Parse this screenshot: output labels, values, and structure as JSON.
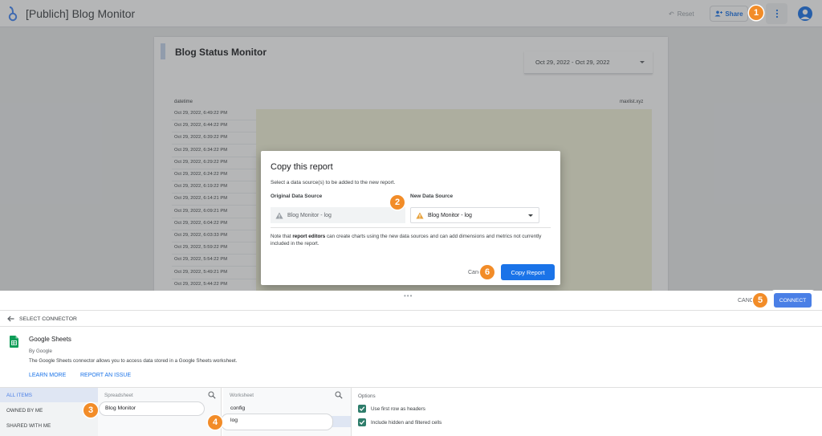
{
  "app": {
    "title": "[Publich] Blog Monitor",
    "reset_label": "Reset",
    "share_label": "Share"
  },
  "report": {
    "title": "Blog Status Monitor",
    "date_range": "Oct 29, 2022 - Oct 29, 2022",
    "columns": [
      "datetime",
      "maxlist.xyz"
    ],
    "rows": [
      "Oct 29, 2022, 6:49:22 PM",
      "Oct 29, 2022, 6:44:22 PM",
      "Oct 29, 2022, 6:39:22 PM",
      "Oct 29, 2022, 6:34:22 PM",
      "Oct 29, 2022, 6:29:22 PM",
      "Oct 29, 2022, 6:24:22 PM",
      "Oct 29, 2022, 6:19:22 PM",
      "Oct 29, 2022, 6:14:21 PM",
      "Oct 29, 2022, 6:09:21 PM",
      "Oct 29, 2022, 6:04:22 PM",
      "Oct 29, 2022, 6:03:33 PM",
      "Oct 29, 2022, 5:59:22 PM",
      "Oct 29, 2022, 5:54:22 PM",
      "Oct 29, 2022, 5:49:21 PM",
      "Oct 29, 2022, 5:44:22 PM"
    ]
  },
  "dialog": {
    "title": "Copy this report",
    "subtitle": "Select a data source(s) to be added to the new report.",
    "original_label": "Original Data Source",
    "new_label": "New Data Source",
    "original_source": "Blog Monitor - log",
    "new_source": "Blog Monitor - log",
    "note_pre": "Note that ",
    "note_bold": "report editors",
    "note_post": " can create charts using the new data sources and can add dimensions and metrics not currently included in the report.",
    "cancel_label": "Canc",
    "copy_label": "Copy Report"
  },
  "connector_panel": {
    "cancel_label": "CANC",
    "connect_label": "CONNECT",
    "select_connector": "SELECT CONNECTOR",
    "connector_name": "Google Sheets",
    "connector_by": "By Google",
    "connector_desc": "The Google Sheets connector allows you to access data stored in a Google Sheets worksheet.",
    "learn_more": "LEARN MORE",
    "report_issue": "REPORT AN ISSUE",
    "categories": [
      "ALL ITEMS",
      "OWNED BY ME",
      "SHARED WITH ME"
    ],
    "spreadsheet_title": "Spreadsheet",
    "spreadsheets": [
      "Blog Monitor"
    ],
    "worksheet_title": "Worksheet",
    "worksheets": [
      "config",
      "log"
    ],
    "options_title": "Options",
    "options": [
      "Use first row as headers",
      "Include hidden and filtered cells"
    ]
  },
  "steps": [
    "1",
    "2",
    "3",
    "4",
    "5",
    "6"
  ],
  "colors": {
    "accent_blue": "#1a73e8",
    "badge_orange": "#f28c28",
    "checkbox_green": "#2e7d6b",
    "warning_orange": "#e8a33d"
  }
}
